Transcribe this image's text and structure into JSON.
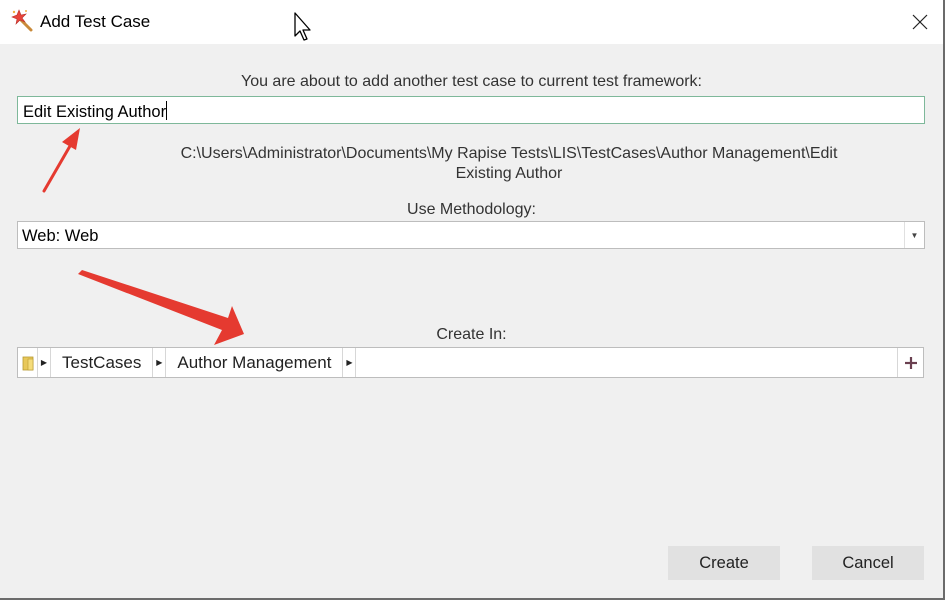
{
  "window": {
    "title": "Add Test Case",
    "app_icon": "magic-wand-icon",
    "close_icon": "close-icon"
  },
  "form": {
    "intro_text": "You are about to add another test case to current test framework:",
    "name_value": "Edit Existing Author",
    "path_line1": "C:\\Users\\Administrator\\Documents\\My Rapise Tests\\LIS\\TestCases\\Author Management\\Edit",
    "path_line2": "Existing Author",
    "methodology_label": "Use Methodology:",
    "methodology_value": "Web: Web",
    "create_in_label": "Create In:",
    "breadcrumb": [
      {
        "label": "TestCases"
      },
      {
        "label": "Author Management"
      }
    ]
  },
  "buttons": {
    "create": "Create",
    "cancel": "Cancel"
  },
  "colors": {
    "annotation_arrow": "#e53a30",
    "input_focus_border": "#7eb89a"
  }
}
